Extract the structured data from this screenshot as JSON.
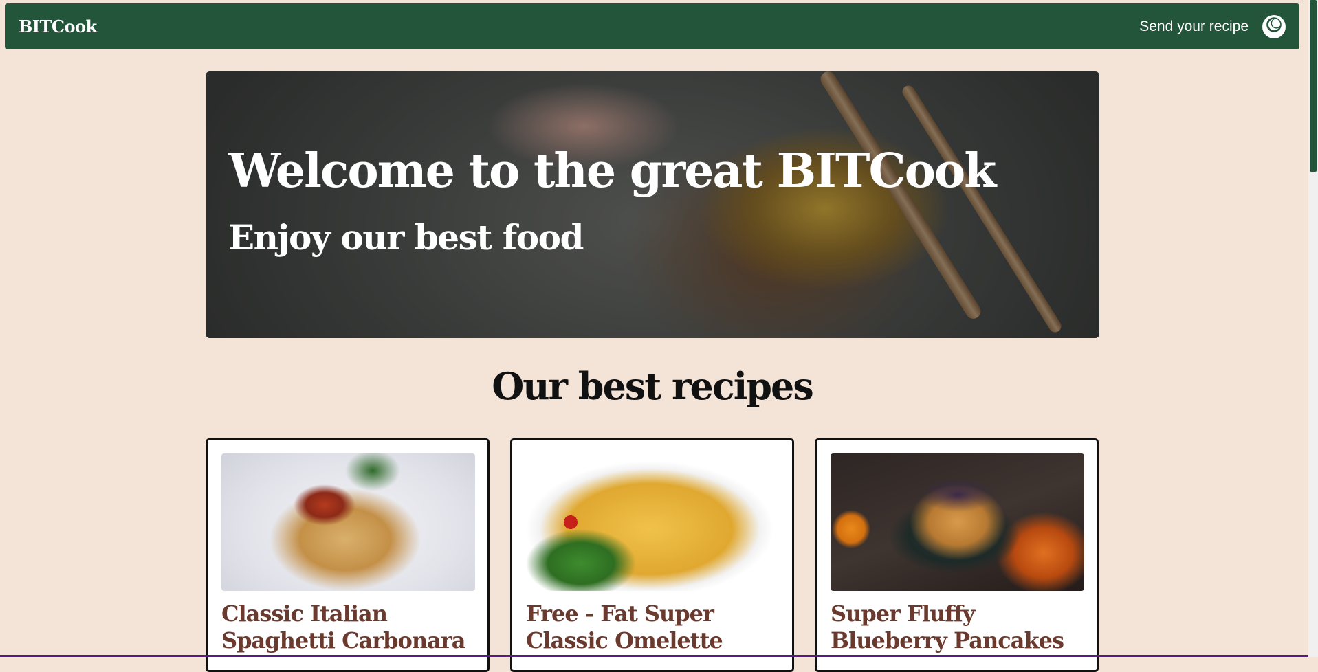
{
  "navbar": {
    "brand": "BITCook",
    "send_recipe_label": "Send your recipe",
    "theme_toggle_icon": "moon-icon",
    "background_color": "#23553a"
  },
  "hero": {
    "title": "Welcome to the great BITCook",
    "subtitle": "Enjoy our best food"
  },
  "recipes_section": {
    "title": "Our best recipes",
    "cards": [
      {
        "title": "Classic Italian Spaghetti Carbonara"
      },
      {
        "title": "Free - Fat Super Classic Omelette"
      },
      {
        "title": "Super Fluffy Blueberry Pancakes"
      }
    ]
  },
  "colors": {
    "page_background": "#f4e4d8",
    "card_title": "#6b3a2e",
    "accent": "#23553a"
  }
}
